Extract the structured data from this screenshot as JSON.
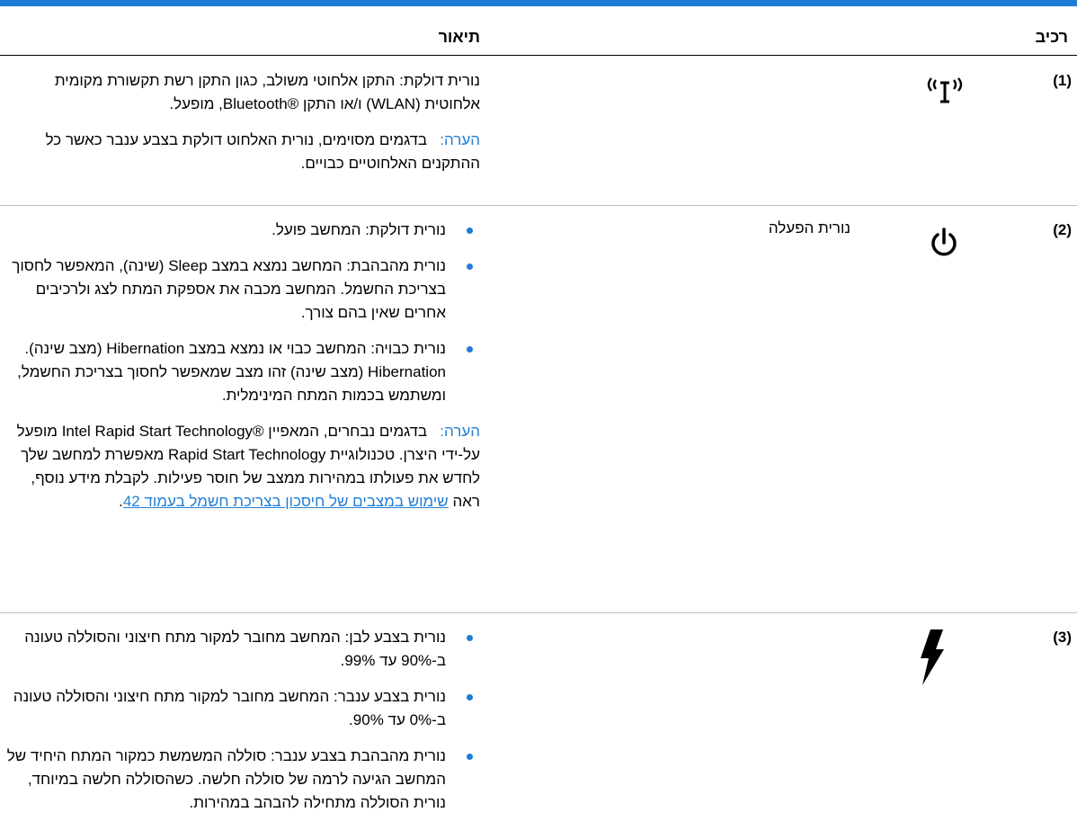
{
  "header": {
    "col_component": "רכיב",
    "col_description": "תיאור"
  },
  "rows": [
    {
      "number": "(1)",
      "icon": "wireless-icon",
      "name": "",
      "paragraphs": [
        "נורית דולקת: התקן אלחוטי משולב, כגון התקן רשת תקשורת מקומית אלחוטית (WLAN) ו/או התקן ®Bluetooth, מופעל."
      ],
      "note_label": "הערה:",
      "note_text": "בדגמים מסוימים, נורית האלחוט דולקת בצבע ענבר כאשר כל ההתקנים האלחוטיים כבויים."
    },
    {
      "number": "(2)",
      "icon": "power-icon",
      "name": "נורית הפעלה",
      "bullets": [
        "נורית דולקת: המחשב פועל.",
        "נורית מהבהבת: המחשב נמצא במצב Sleep (שינה), המאפשר לחסוך בצריכת החשמל. המחשב מכבה את אספקת המתח לצג ולרכיבים אחרים שאין בהם צורך.",
        "נורית כבויה: המחשב כבוי או נמצא במצב Hibernation (מצב שינה). Hibernation (מצב שינה) זהו מצב שמאפשר לחסוך בצריכת החשמל, ומשתמש בכמות המתח המינימלית."
      ],
      "note_label": "הערה:",
      "note_text": "בדגמים נבחרים, המאפיין ®Intel Rapid Start Technology מופעל על-ידי היצרן. טכנולוגיית Rapid Start Technology מאפשרת למחשב שלך לחדש את פעולתו במהירות ממצב של חוסר פעילות. לקבלת מידע נוסף, ראה",
      "note_link": "שימוש במצבים של חיסכון בצריכת חשמל בעמוד 42",
      "note_end": "."
    },
    {
      "number": "(3)",
      "icon": "battery-lightning-icon",
      "name": "",
      "bullets": [
        "נורית בצבע לבן: המחשב מחובר למקור מתח חיצוני והסוללה טעונה ב-90% עד 99%.",
        "נורית בצבע ענבר: המחשב מחובר למקור מתח חיצוני והסוללה טעונה ב-0% עד 90%.",
        "נורית מהבהבת בצבע ענבר: סוללה המשמשת כמקור המתח היחיד של המחשב הגיעה לרמה של סוללה חלשה. כשהסוללה חלשה במיוחד, נורית הסוללה מתחילה להבהב במהירות."
      ]
    }
  ],
  "colors": {
    "accent": "#1f7dd6"
  }
}
